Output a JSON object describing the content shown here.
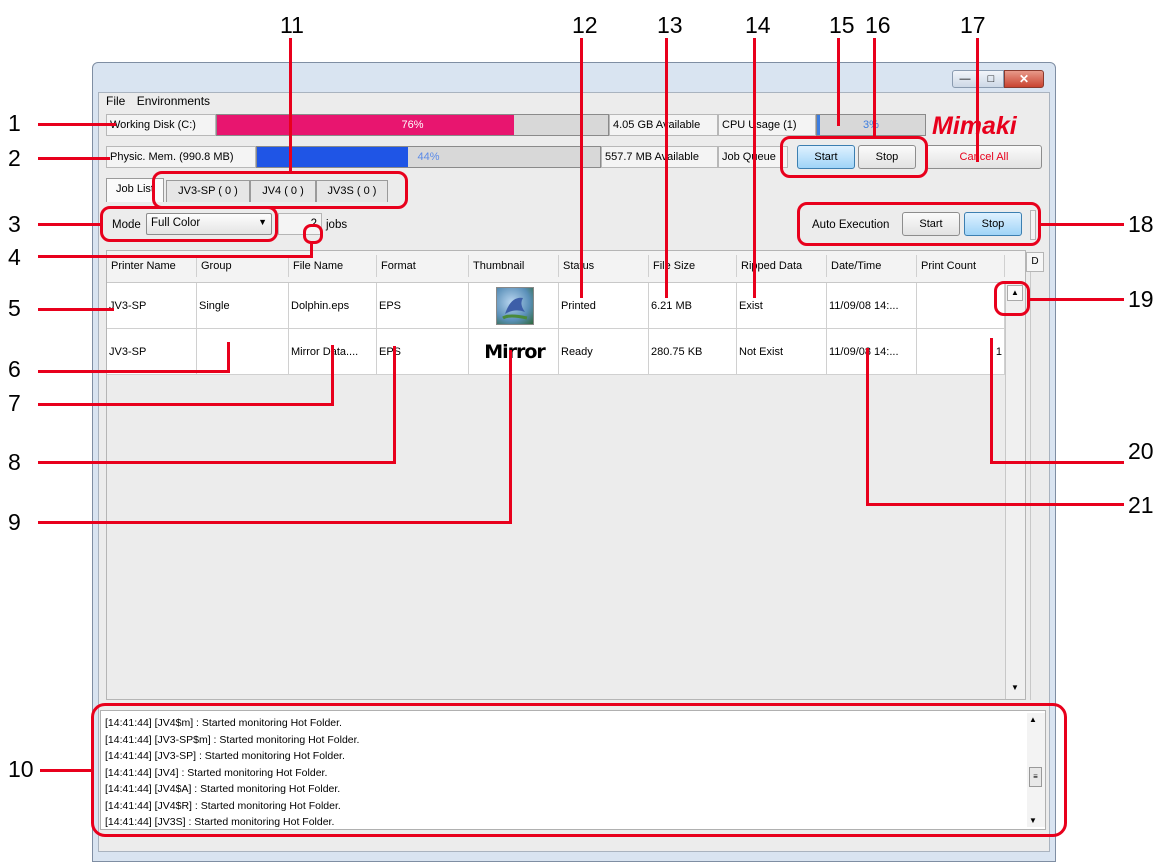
{
  "callouts": [
    "1",
    "2",
    "3",
    "4",
    "5",
    "6",
    "7",
    "8",
    "9",
    "10",
    "11",
    "12",
    "13",
    "14",
    "15",
    "16",
    "17",
    "18",
    "19",
    "20",
    "21"
  ],
  "menu": {
    "file": "File",
    "environments": "Environments"
  },
  "disk": {
    "label": "Working Disk (C:)",
    "percent_text": "76%",
    "fraction": 0.76,
    "available": "4.05 GB Available",
    "color": "#e8156f"
  },
  "cpu": {
    "label": "CPU Usage (1)",
    "percent_text": "3%",
    "fraction": 0.03
  },
  "mem": {
    "label": "Physic. Mem. (990.8 MB)",
    "percent_text": "44%",
    "fraction": 0.44,
    "available": "557.7 MB Available",
    "color": "#1f55e6"
  },
  "job_queue": {
    "label": "Job Queue",
    "start": "Start",
    "stop": "Stop",
    "cancel_all": "Cancel All"
  },
  "logo": "Mimaki",
  "tabs": [
    "Job List",
    "JV3-SP ( 0 )",
    "JV4 ( 0 )",
    "JV3S ( 0 )"
  ],
  "mode": {
    "label": "Mode",
    "value": "Full Color"
  },
  "jobs": {
    "count": "2",
    "label": "jobs"
  },
  "auto_execution": {
    "label": "Auto Execution",
    "start": "Start",
    "stop": "Stop"
  },
  "table": {
    "headers": [
      "Printer Name",
      "Group",
      "File Name",
      "Format",
      "Thumbnail",
      "Status",
      "File Size",
      "Ripped Data",
      "Date/Time",
      "Print Count"
    ],
    "rows": [
      {
        "printer": "JV3-SP",
        "group": "Single",
        "file": "Dolphin.eps",
        "format": "EPS",
        "thumb": "",
        "status": "Printed",
        "size": "6.21 MB",
        "ripped": "Exist",
        "datetime": "11/09/08 14:...",
        "count": ""
      },
      {
        "printer": "JV3-SP",
        "group": "",
        "file": "Mirror Data....",
        "format": "EPS",
        "thumb": "Mirror",
        "status": "Ready",
        "size": "280.75 KB",
        "ripped": "Not Exist",
        "datetime": "11/09/08 14:...",
        "count": "1"
      }
    ]
  },
  "log": [
    "[14:41:44] [JV4$m] : Started monitoring Hot Folder.",
    "[14:41:44] [JV3-SP$m] : Started monitoring Hot Folder.",
    "[14:41:44] [JV3-SP] : Started monitoring Hot Folder.",
    "[14:41:44] [JV4] : Started monitoring Hot Folder.",
    "[14:41:44] [JV4$A] : Started monitoring Hot Folder.",
    "[14:41:44] [JV4$R] : Started monitoring Hot Folder.",
    "[14:41:44] [JV3S] : Started monitoring Hot Folder."
  ],
  "colors": {
    "annotation": "#e8001c",
    "accent_blue": "#9fd4f7"
  }
}
